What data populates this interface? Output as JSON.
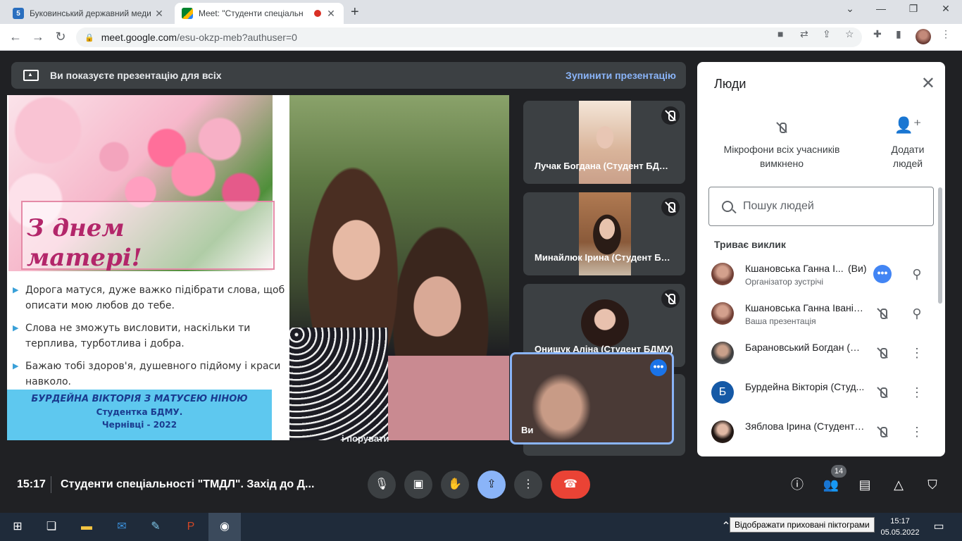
{
  "browser": {
    "tabs": [
      {
        "title": "Буковинський державний меди",
        "active": false,
        "favicon": "5"
      },
      {
        "title": "Meet: \"Студенти спеціальн",
        "active": true,
        "recording": true
      }
    ],
    "url_host": "meet.google.com",
    "url_path": "/esu-okzp-meb?authuser=0"
  },
  "banner": {
    "text": "Ви показуєте презентацію для всіх",
    "stop_label": "Зупинити презентацію"
  },
  "slide": {
    "greeting_line1": "З днем",
    "greeting_line2": "матері!",
    "bullets": [
      "Дорога матуся, дуже важко підібрати слова, щоб описати мою любов до тебе.",
      "Слова не зможуть висловити, наскільки ти терплива, турботлива  і добра.",
      "Бажаю тобі здоров'я, душевного підйому і краси навколо."
    ],
    "footer_line1": "БУРДЕЙНА ВІКТОРІЯ З МАТУСЕЮ  НІНОЮ",
    "footer_line2": "Студентка БДМУ.",
    "footer_line3": "Чернівці - 2022"
  },
  "overlay_text": "і порувати",
  "tiles": [
    {
      "name": "Лучак Богдана (Студент БДМУ)",
      "muted": true
    },
    {
      "name": "Минайлюк Ірина (Студент БДМУ)",
      "muted": true
    },
    {
      "name": "Онищук Аліна (Студент БДМУ)",
      "muted": true
    }
  ],
  "self_view": {
    "label": "Ви"
  },
  "people_panel": {
    "title": "Люди",
    "mute_all_label_line1": "Мікрофони всіх учасників",
    "mute_all_label_line2": "вимкнено",
    "add_people_label_line1": "Додати",
    "add_people_label_line2": "людей",
    "search_placeholder": "Пошук людей",
    "section_title": "Триває виклик",
    "participants": [
      {
        "name": "Кшановська Ганна І...",
        "tag": "(Ви)",
        "subtitle": "Організатор зустрічі"
      },
      {
        "name": "Кшановська Ганна Іванів...",
        "tag": "",
        "subtitle": "Ваша презентація"
      },
      {
        "name": "Барановський Богдан (Студ...",
        "tag": "",
        "subtitle": ""
      },
      {
        "name": "Бурдейна Вікторія (Студ...",
        "tag": "",
        "subtitle": "",
        "initial": "Б"
      },
      {
        "name": "Зяблова Ірина (Студент БД...",
        "tag": "",
        "subtitle": ""
      }
    ]
  },
  "bottom_bar": {
    "time": "15:17",
    "meeting_title": "Студенти спеціальності \"ТМДЛ\". Захід до Д...",
    "participant_count": "14"
  },
  "taskbar": {
    "clock_time": "15:17",
    "clock_date": "05.05.2022",
    "tooltip": "Відображати приховані піктограми"
  },
  "colors": {
    "meet_bg": "#202124",
    "accent_blue": "#8ab4f8",
    "end_call_red": "#ea4335"
  }
}
